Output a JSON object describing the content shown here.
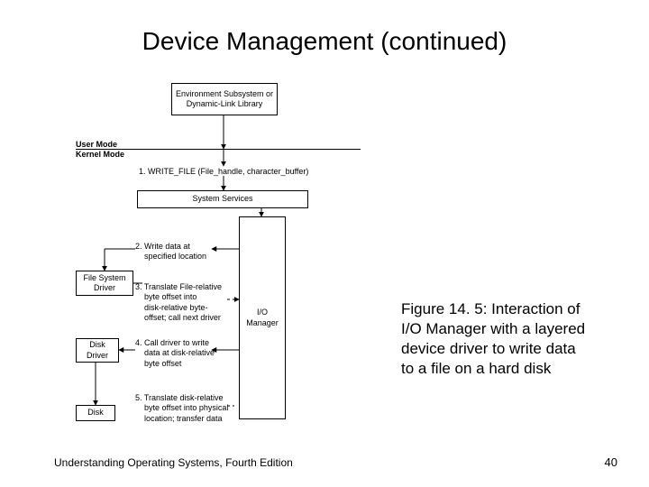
{
  "title": "Device Management (continued)",
  "mode_labels": {
    "user": "User Mode",
    "kernel": "Kernel Mode"
  },
  "boxes": {
    "env": "Environment Subsystem\nor\nDynamic-Link Library",
    "sysserv": "System Services",
    "iomgr": "I/O\nManager",
    "fsd": "File System\nDriver",
    "dd": "Disk\nDriver",
    "disk": "Disk"
  },
  "steps": {
    "s1": "1. WRITE_FILE (File_handle, character_buffer)",
    "s2": "2. Write data at\n    specified location",
    "s3": "3. Translate File-relative\n    byte offset into\n    disk-relative byte-\n    offset; call next driver",
    "s4": "4. Call driver to write\n    data at disk-relative\n    byte offset",
    "s5": "5. Translate disk-relative\n    byte offset into physical\n    location; transfer data"
  },
  "caption": "Figure 14. 5: Interaction of  I/O Manager with a layered device driver to write data to a file on a hard disk",
  "footer": "Understanding Operating Systems, Fourth Edition",
  "pagenum": "40"
}
